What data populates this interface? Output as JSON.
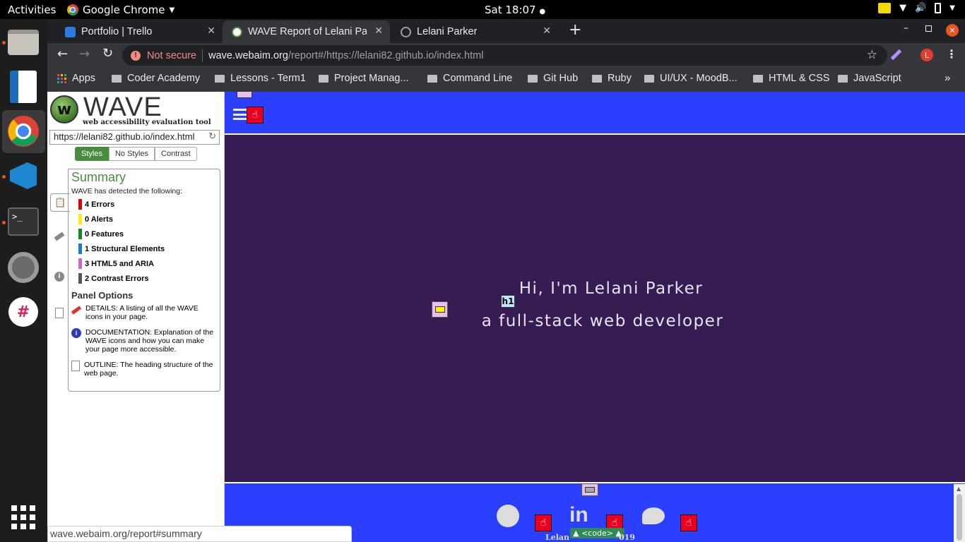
{
  "topbar": {
    "activities": "Activities",
    "app_name": "Google Chrome",
    "clock": "Sat 18:07"
  },
  "dock": {
    "items": [
      "files-app",
      "writer-app",
      "chrome-app",
      "vscode-app",
      "terminal-app",
      "settings-app",
      "slack-app",
      "show-apps"
    ]
  },
  "tabs": [
    {
      "title": "Portfolio | Trello",
      "favicon": "trello-icon",
      "active": false
    },
    {
      "title": "WAVE Report of Lelani Pa",
      "favicon": "wave-icon",
      "active": true
    },
    {
      "title": "Lelani Parker",
      "favicon": "globe-icon",
      "active": false
    }
  ],
  "omnibox": {
    "security": "Not secure",
    "host": "wave.webaim.org",
    "path": "/report#/https://lelani82.github.io/index.html",
    "avatar": "L"
  },
  "bookmarks": [
    {
      "label": "Apps",
      "type": "apps"
    },
    {
      "label": "Coder Academy"
    },
    {
      "label": "Lessons - Term1"
    },
    {
      "label": "Project Manag..."
    },
    {
      "label": "Command Line"
    },
    {
      "label": "Git Hub"
    },
    {
      "label": "Ruby"
    },
    {
      "label": "UI/UX - MoodB..."
    },
    {
      "label": "HTML & CSS"
    },
    {
      "label": "JavaScript"
    }
  ],
  "wave": {
    "logo": "WAVE",
    "tagline": "web accessibility evaluation tool",
    "url": "https://lelani82.github.io/index.html",
    "style_tabs": [
      "Styles",
      "No Styles",
      "Contrast"
    ],
    "summary_title": "Summary",
    "detected": "WAVE has detected the following:",
    "items": [
      {
        "label": "4 Errors",
        "color": "#e10000"
      },
      {
        "label": "0 Alerts",
        "color": "#ffee00"
      },
      {
        "label": "0 Features",
        "color": "#138a1d"
      },
      {
        "label": "1 Structural Elements",
        "color": "#1a78d8"
      },
      {
        "label": "3 HTML5 and ARIA",
        "color": "#cc66cc"
      },
      {
        "label": "2 Contrast Errors",
        "color": "#555555"
      }
    ],
    "panel_title": "Panel Options",
    "panel_options": [
      {
        "icon": "flag-icon",
        "text": "DETAILS: A listing of all the WAVE icons in your page."
      },
      {
        "icon": "info-icon",
        "text": "DOCUMENTATION: Explanation of the WAVE icons and how you can make your page more accessible."
      },
      {
        "icon": "outline-icon",
        "text": "OUTLINE: The heading structure of the web page."
      }
    ]
  },
  "site": {
    "h1_badge": "h1",
    "hero_line1": "Hi, I'm Lelani Parker",
    "hero_line2": "a full-stack web developer",
    "code_badge": "▲ <code> ▲",
    "footer_left": "Lelan",
    "footer_right": "019"
  },
  "status": "wave.webaim.org/report#summary"
}
